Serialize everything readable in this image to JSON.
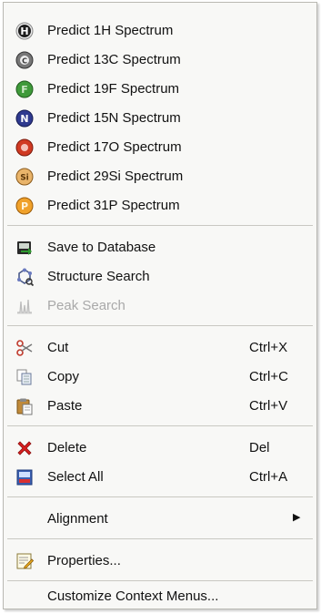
{
  "menu": {
    "items": [
      {
        "label": "Predict 1H Spectrum",
        "icon": "hydrogen-element-icon",
        "letter": "H",
        "color": "#2a2a2a"
      },
      {
        "label": "Predict 13C Spectrum",
        "icon": "carbon-element-icon",
        "letter": "C",
        "color": "#555555"
      },
      {
        "label": "Predict 19F Spectrum",
        "icon": "fluorine-element-icon",
        "letter": "F",
        "color": "#3f9a3a"
      },
      {
        "label": "Predict 15N Spectrum",
        "icon": "nitrogen-element-icon",
        "letter": "N",
        "color": "#2f3a8f"
      },
      {
        "label": "Predict 17O Spectrum",
        "icon": "oxygen-element-icon",
        "letter": "O",
        "color": "#d03a22"
      },
      {
        "label": "Predict 29Si Spectrum",
        "icon": "silicon-element-icon",
        "letter": "Si",
        "color": "#d08a2a"
      },
      {
        "label": "Predict 31P Spectrum",
        "icon": "phosphorus-element-icon",
        "letter": "P",
        "color": "#e3901c"
      },
      {
        "label": "Save to Database",
        "icon": "save-to-database-icon"
      },
      {
        "label": "Structure Search",
        "icon": "structure-search-icon"
      },
      {
        "label": "Peak Search",
        "icon": "peak-search-icon",
        "disabled": true
      },
      {
        "label": "Cut",
        "icon": "scissors-icon",
        "shortcut": "Ctrl+X"
      },
      {
        "label": "Copy",
        "icon": "copy-icon",
        "shortcut": "Ctrl+C"
      },
      {
        "label": "Paste",
        "icon": "paste-icon",
        "shortcut": "Ctrl+V"
      },
      {
        "label": "Delete",
        "icon": "delete-icon",
        "shortcut": "Del"
      },
      {
        "label": "Select All",
        "icon": "select-all-icon",
        "shortcut": "Ctrl+A"
      },
      {
        "label": "Alignment",
        "icon": "",
        "submenu": true
      },
      {
        "label": "Properties...",
        "icon": "properties-icon"
      },
      {
        "label": "Customize Context Menus...",
        "icon": ""
      }
    ],
    "submenu_arrow": "▶"
  }
}
